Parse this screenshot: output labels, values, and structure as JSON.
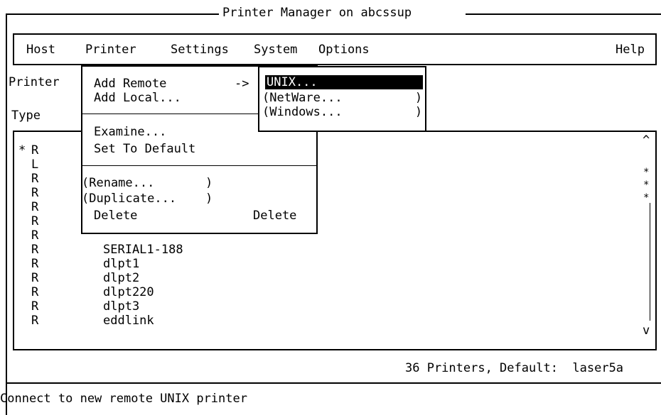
{
  "window": {
    "title": "Printer Manager on abcssup"
  },
  "menubar": {
    "items": [
      {
        "label": "Host"
      },
      {
        "label": "Printer"
      },
      {
        "label": "Settings"
      },
      {
        "label": "System"
      },
      {
        "label": "Options"
      },
      {
        "label": "Help"
      }
    ]
  },
  "fields": {
    "printer_label": "Printer",
    "type_label": "Type"
  },
  "printer_menu": {
    "items": [
      {
        "label": "Add Remote",
        "accel": "->"
      },
      {
        "label": "Add Local..."
      },
      {
        "label": "Examine..."
      },
      {
        "label": "Set To Default"
      },
      {
        "label": "(Rename...       )"
      },
      {
        "label": "(Duplicate...    )"
      },
      {
        "label": "Delete",
        "accel": "Delete"
      }
    ]
  },
  "remote_submenu": {
    "items": [
      {
        "label": "UNIX...",
        "selected": true
      },
      {
        "label": "(NetWare...          )"
      },
      {
        "label": "(Windows...          )"
      }
    ]
  },
  "printer_list": {
    "rows": [
      {
        "marker": "*",
        "type": "R",
        "name": ""
      },
      {
        "marker": "",
        "type": "L",
        "name": ""
      },
      {
        "marker": "",
        "type": "R",
        "name": ""
      },
      {
        "marker": "",
        "type": "R",
        "name": ""
      },
      {
        "marker": "",
        "type": "R",
        "name": ""
      },
      {
        "marker": "",
        "type": "R",
        "name": ""
      },
      {
        "marker": "",
        "type": "R",
        "name": "SERIAL1-188"
      },
      {
        "marker": "",
        "type": "R",
        "name": "dlpt1"
      },
      {
        "marker": "",
        "type": "R",
        "name": "dlpt2"
      },
      {
        "marker": "",
        "type": "R",
        "name": "dlpt220"
      },
      {
        "marker": "",
        "type": "R",
        "name": "dlpt3"
      },
      {
        "marker": "",
        "type": "R",
        "name": "eddlink"
      }
    ],
    "scroll_up": "^",
    "scroll_down": "v",
    "scroll_marks": [
      "*",
      "*",
      "*"
    ]
  },
  "status": {
    "summary": "36 Printers, Default:  laser5a",
    "help_line": "Connect to new remote UNIX printer"
  }
}
